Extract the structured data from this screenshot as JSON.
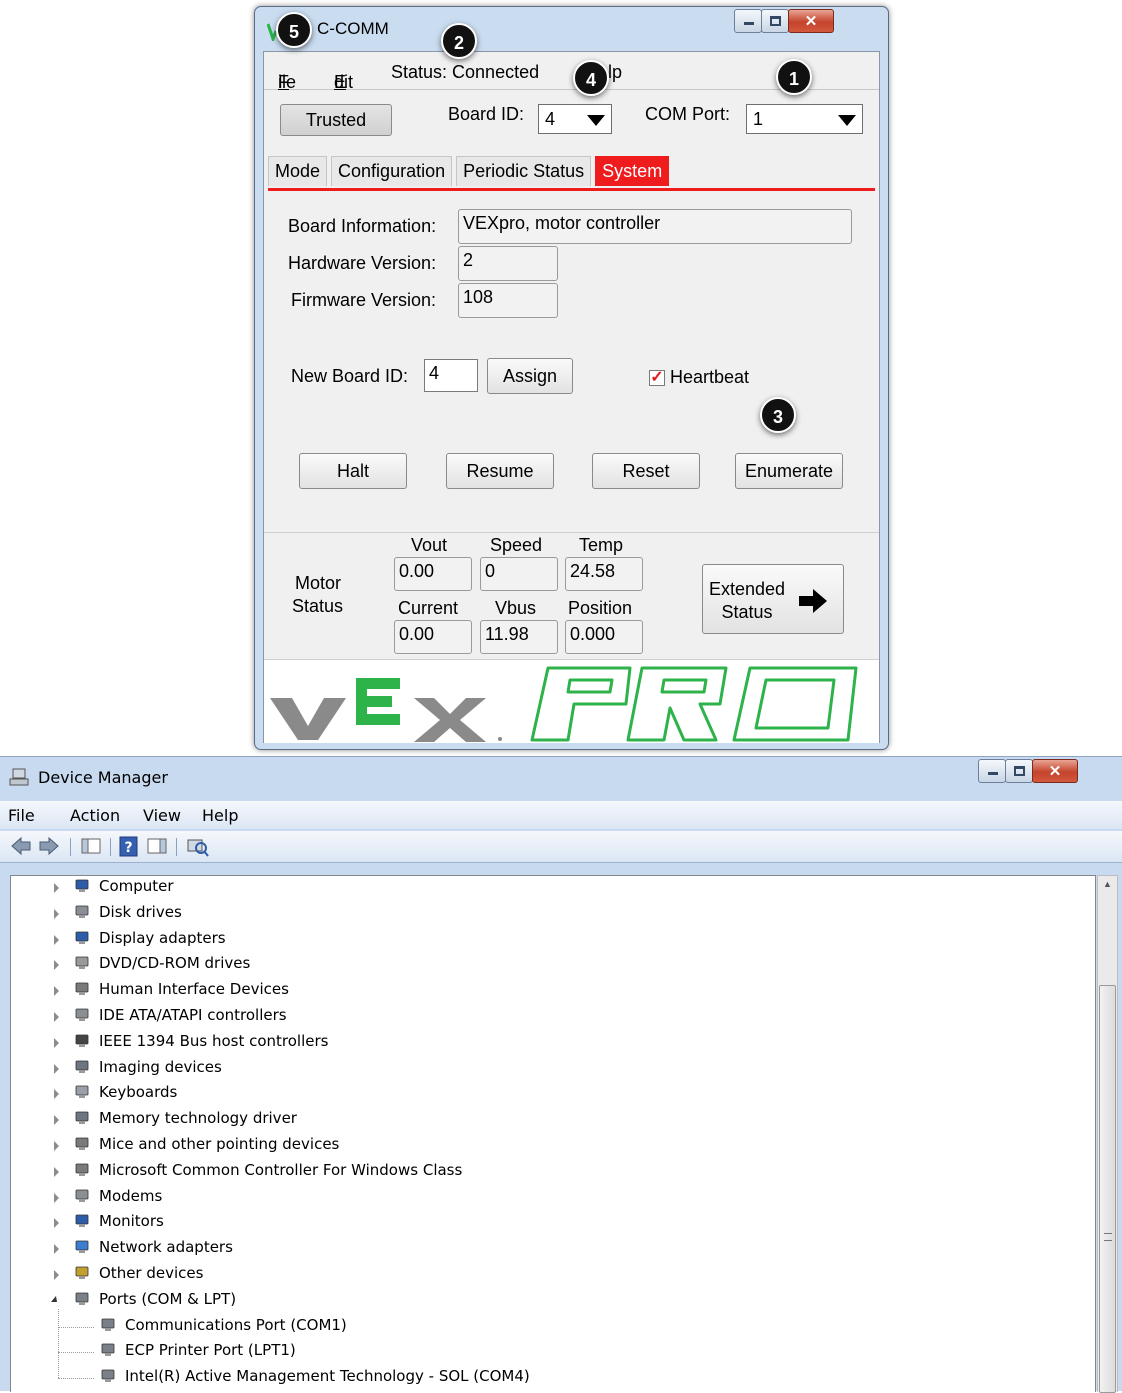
{
  "bdc": {
    "title": "C-COMM",
    "menu": {
      "file": "File",
      "edit": "Edit",
      "status": "Status: Connected",
      "help": "lp"
    },
    "trusted": "Trusted",
    "board_id_label": "Board ID:",
    "board_id_value": "4",
    "com_port_label": "COM Port:",
    "com_port_value": "1",
    "tabs": [
      "Mode",
      "Configuration",
      "Periodic Status",
      "System"
    ],
    "active_tab": "System",
    "system": {
      "board_info_label": "Board Information:",
      "board_info_value": "VEXpro, motor controller",
      "hw_label": "Hardware Version:",
      "hw_value": "2",
      "fw_label": "Firmware Version:",
      "fw_value": "108",
      "new_id_label": "New Board ID:",
      "new_id_value": "4",
      "assign": "Assign",
      "heartbeat": "Heartbeat",
      "heartbeat_checked": true,
      "halt": "Halt",
      "resume": "Resume",
      "reset": "Reset",
      "enumerate": "Enumerate"
    },
    "motor": {
      "label_line1": "Motor",
      "label_line2": "Status",
      "vout_label": "Vout",
      "vout": "0.00",
      "speed_label": "Speed",
      "speed": "0",
      "temp_label": "Temp",
      "temp": "24.58",
      "current_label": "Current",
      "current": "0.00",
      "vbus_label": "Vbus",
      "vbus": "11.98",
      "position_label": "Position",
      "position": "0.000",
      "extended_line1": "Extended",
      "extended_line2": "Status"
    },
    "logo_text_vex": "vEx",
    "logo_text_pro": "PRO",
    "colors": {
      "accent": "#ee1c1c",
      "logo_green": "#2db34a",
      "logo_grey": "#8a8a8a"
    }
  },
  "callouts": [
    "1",
    "2",
    "3",
    "4",
    "5"
  ],
  "device_manager": {
    "title": "Device Manager",
    "menu": [
      "File",
      "Action",
      "View",
      "Help"
    ],
    "tree": [
      {
        "label": "Computer",
        "icon": "computer-icon",
        "expanded": false
      },
      {
        "label": "Disk drives",
        "icon": "disk-drive-icon",
        "expanded": false
      },
      {
        "label": "Display adapters",
        "icon": "display-adapter-icon",
        "expanded": false
      },
      {
        "label": "DVD/CD-ROM drives",
        "icon": "dvd-drive-icon",
        "expanded": false
      },
      {
        "label": "Human Interface Devices",
        "icon": "hid-icon",
        "expanded": false
      },
      {
        "label": "IDE ATA/ATAPI controllers",
        "icon": "ide-controller-icon",
        "expanded": false
      },
      {
        "label": "IEEE 1394 Bus host controllers",
        "icon": "firewire-icon",
        "expanded": false
      },
      {
        "label": "Imaging devices",
        "icon": "imaging-icon",
        "expanded": false
      },
      {
        "label": "Keyboards",
        "icon": "keyboard-icon",
        "expanded": false
      },
      {
        "label": "Memory technology driver",
        "icon": "memory-icon",
        "expanded": false
      },
      {
        "label": "Mice and other pointing devices",
        "icon": "mouse-icon",
        "expanded": false
      },
      {
        "label": "Microsoft Common Controller For Windows Class",
        "icon": "controller-icon",
        "expanded": false
      },
      {
        "label": "Modems",
        "icon": "modem-icon",
        "expanded": false
      },
      {
        "label": "Monitors",
        "icon": "monitor-icon",
        "expanded": false
      },
      {
        "label": "Network adapters",
        "icon": "network-icon",
        "expanded": false
      },
      {
        "label": "Other devices",
        "icon": "unknown-device-icon",
        "expanded": false
      },
      {
        "label": "Ports (COM & LPT)",
        "icon": "port-icon",
        "expanded": true
      },
      {
        "label": "Communications Port (COM1)",
        "icon": "port-icon",
        "child": true
      },
      {
        "label": "ECP Printer Port (LPT1)",
        "icon": "port-icon",
        "child": true
      },
      {
        "label": "Intel(R) Active Management Technology - SOL (COM4)",
        "icon": "port-icon",
        "child": true
      }
    ]
  }
}
